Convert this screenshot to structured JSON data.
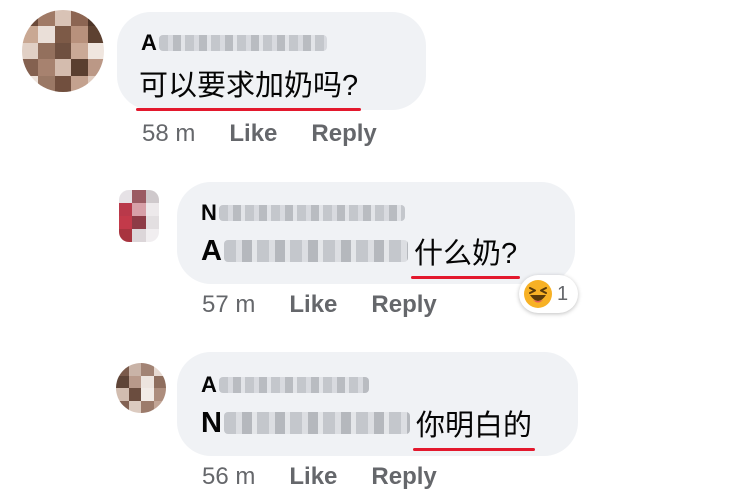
{
  "colors": {
    "bubble_bg": "#f0f2f5",
    "meta_text": "#65676b",
    "underline": "#e3182d",
    "reaction_emoji": "#f7b125"
  },
  "comments": [
    {
      "author_initial": "A",
      "message_prefix_initial": "",
      "message": "可以要求加奶吗?",
      "time": "58 m",
      "like_label": "Like",
      "reply_label": "Reply"
    },
    {
      "author_initial": "N",
      "message_prefix_initial": "A",
      "message": "什么奶?",
      "time": "57 m",
      "like_label": "Like",
      "reply_label": "Reply",
      "reaction": {
        "icon": "laughing-emoji-icon",
        "count": "1"
      }
    },
    {
      "author_initial": "A",
      "message_prefix_initial": "N",
      "message": "你明白的",
      "time": "56 m",
      "like_label": "Like",
      "reply_label": "Reply"
    }
  ]
}
